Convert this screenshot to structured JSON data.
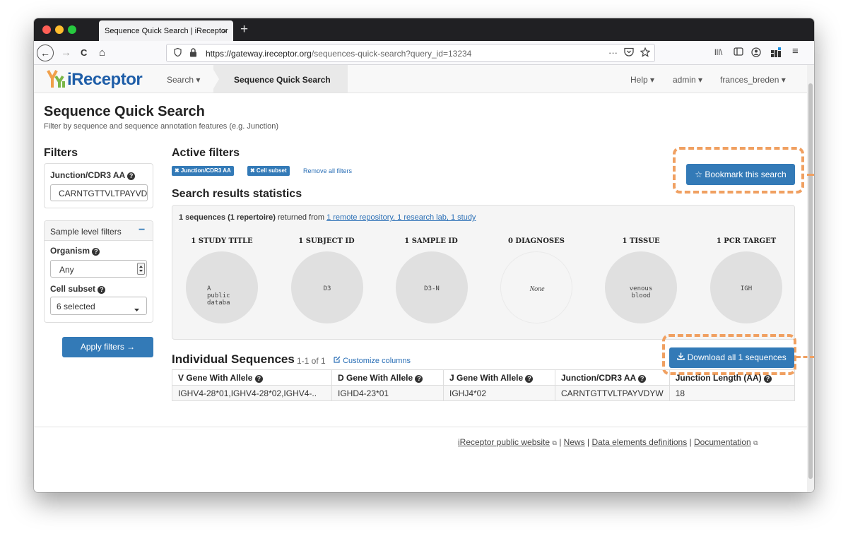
{
  "browser": {
    "tab_title": "Sequence Quick Search | iReceptor",
    "tab_close": "×",
    "new_tab": "+",
    "back": "←",
    "forward": "→",
    "reload": "C",
    "home": "⌂",
    "url_host": "https://gateway.ireceptor.org",
    "url_path": "/sequences-quick-search?query_id=13234",
    "page_actions": "···",
    "library_icon": "lll\\",
    "menu_icon": "≡"
  },
  "site": {
    "logo_text": "iReceptor",
    "nav_search": "Search ▾",
    "breadcrumb_active": "Sequence Quick Search",
    "nav_help": "Help ▾",
    "nav_admin": "admin ▾",
    "nav_user": "frances_breden ▾"
  },
  "page": {
    "title": "Sequence Quick Search",
    "subtitle": "Filter by sequence and sequence annotation features (e.g. Junction)"
  },
  "filters": {
    "heading": "Filters",
    "junction_label": "Junction/CDR3 AA",
    "junction_value": "CARNTGTTVLTPAYVD",
    "sample_panel_title": "Sample level filters",
    "collapse_symbol": "−",
    "organism_label": "Organism",
    "organism_value": "Any",
    "cell_subset_label": "Cell subset",
    "cell_subset_value": "6 selected",
    "apply_label": "Apply filters →"
  },
  "active_filters": {
    "heading": "Active filters",
    "chips": [
      "✖ Junction/CDR3 AA",
      "✖ Cell subset"
    ],
    "remove_all": "Remove all filters",
    "bookmark_label": "☆ Bookmark this search"
  },
  "stats": {
    "heading": "Search results statistics",
    "summary_bold": "1 sequences (1 repertoire)",
    "summary_text": " returned from ",
    "summary_link": "1 remote repository, 1 research lab, 1 study",
    "items": [
      {
        "label": "1 STUDY TITLE",
        "value": "A\npublic\ndataba"
      },
      {
        "label": "1 SUBJECT ID",
        "value": "D3"
      },
      {
        "label": "1 SAMPLE ID",
        "value": "D3-N"
      },
      {
        "label": "0 DIAGNOSES",
        "value": "None"
      },
      {
        "label": "1 TISSUE",
        "value": "venous\nblood"
      },
      {
        "label": "1 PCR TARGET",
        "value": "IGH"
      }
    ]
  },
  "sequences": {
    "heading": "Individual Sequences",
    "count": "1-1 of 1",
    "customize": "Customize columns",
    "download_label": "Download all 1 sequences",
    "columns": [
      "V Gene With Allele",
      "D Gene With Allele",
      "J Gene With Allele",
      "Junction/CDR3 AA",
      "Junction Length (AA)"
    ],
    "rows": [
      [
        "IGHV4-28*01,IGHV4-28*02,IGHV4-..",
        "IGHD4-23*01",
        "IGHJ4*02",
        "CARNTGTTVLTPAYVDYW",
        "18"
      ]
    ]
  },
  "footer": {
    "website": "iReceptor public website",
    "news": "News",
    "definitions": "Data elements definitions",
    "documentation": "Documentation"
  },
  "colors": {
    "primary": "#337ab7",
    "logo": "#1f5ea8",
    "highlight": "#f0a061"
  }
}
